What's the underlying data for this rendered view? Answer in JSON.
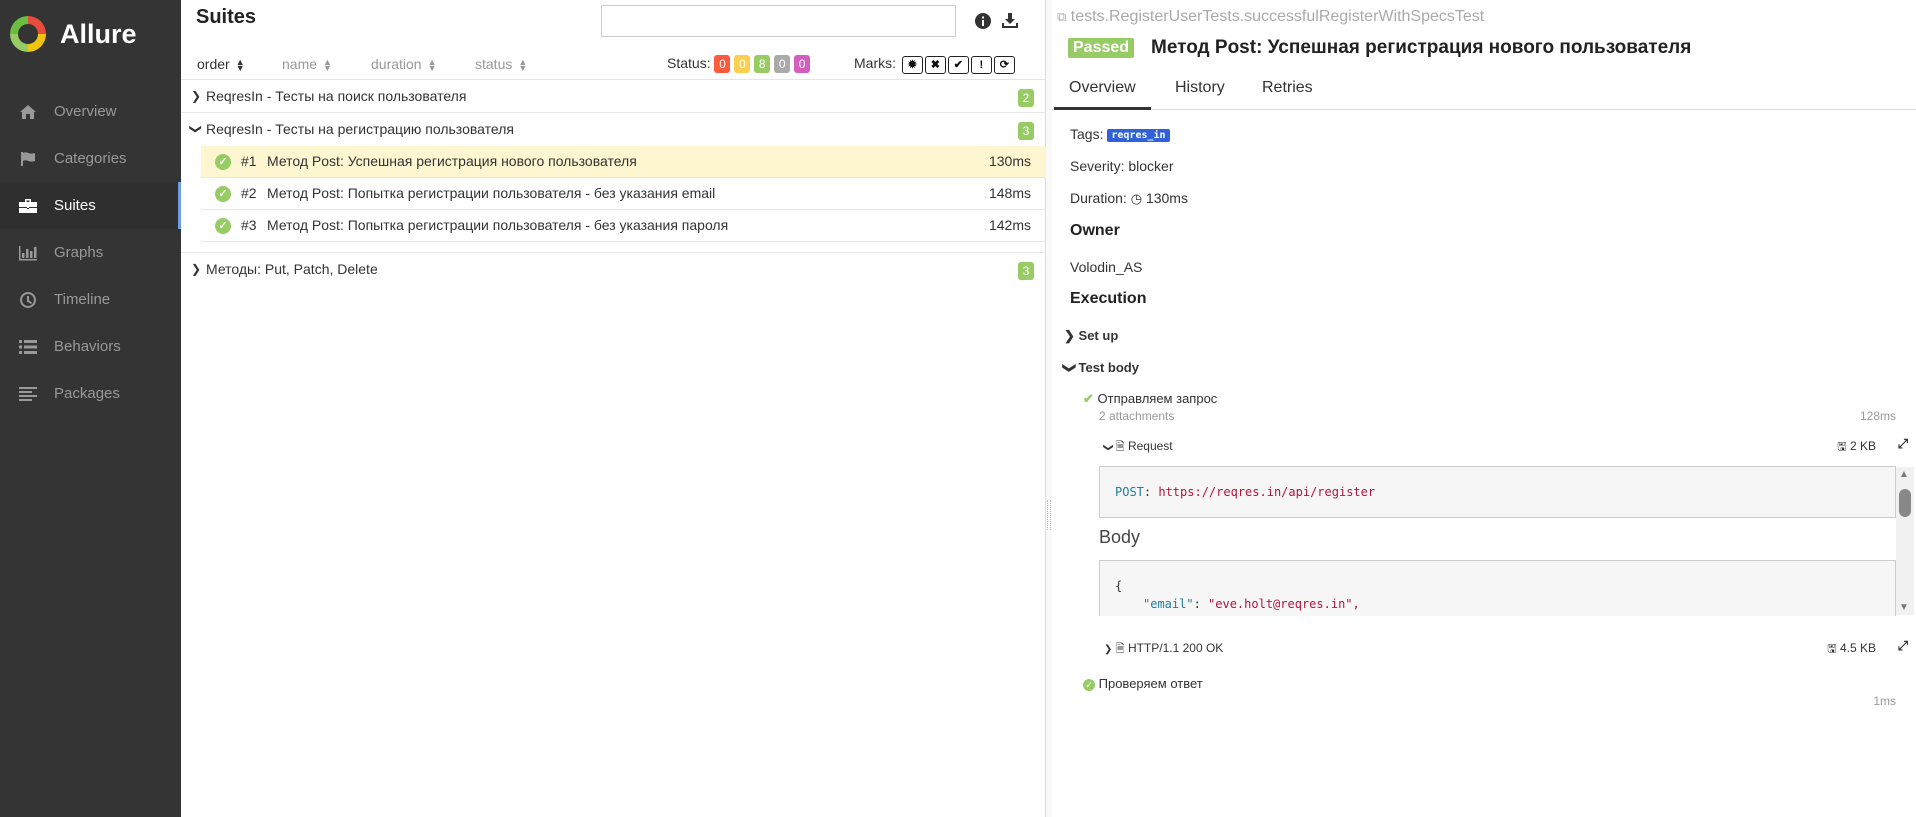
{
  "app": {
    "title": "Allure"
  },
  "sidebar": {
    "items": [
      {
        "label": "Overview",
        "icon": "home-icon"
      },
      {
        "label": "Categories",
        "icon": "flag-icon"
      },
      {
        "label": "Suites",
        "icon": "briefcase-icon",
        "active": true
      },
      {
        "label": "Graphs",
        "icon": "bar-chart-icon"
      },
      {
        "label": "Timeline",
        "icon": "clock-icon"
      },
      {
        "label": "Behaviors",
        "icon": "list-icon"
      },
      {
        "label": "Packages",
        "icon": "align-left-icon"
      }
    ]
  },
  "suites": {
    "title": "Suites",
    "search": {
      "value": "",
      "placeholder": ""
    },
    "sort": {
      "order": "order",
      "name": "name",
      "duration": "duration",
      "status": "status"
    },
    "status_label": "Status:",
    "status_counts": [
      {
        "value": "0",
        "color": "#fd5a3e"
      },
      {
        "value": "0",
        "color": "#ffd050"
      },
      {
        "value": "8",
        "color": "#97cc64"
      },
      {
        "value": "0",
        "color": "#aaaaaa"
      },
      {
        "value": "0",
        "color": "#d35ebe"
      }
    ],
    "marks_label": "Marks:",
    "marks": [
      "flaky-icon",
      "new-failed-icon",
      "new-passed-icon",
      "new-broken-icon",
      "retries-icon"
    ],
    "groups": [
      {
        "name": "ReqresIn - Тесты на поиск пользователя",
        "count": "2",
        "expanded": false
      },
      {
        "name": "ReqresIn - Тесты на регистрацию пользователя",
        "count": "3",
        "expanded": true
      },
      {
        "name": "Методы: Put, Patch, Delete",
        "count": "3",
        "expanded": false
      }
    ],
    "tests": [
      {
        "num": "#1",
        "name": "Метод Post: Успешная регистрация нового пользователя",
        "duration": "130ms",
        "selected": true
      },
      {
        "num": "#2",
        "name": "Метод Post: Попытка регистрации пользователя - без указания email",
        "duration": "148ms"
      },
      {
        "num": "#3",
        "name": "Метод Post: Попытка регистрации пользователя - без указания пароля",
        "duration": "142ms"
      }
    ]
  },
  "detail": {
    "path": "tests.RegisterUserTests.successfulRegisterWithSpecsTest",
    "status": "Passed",
    "title": "Метод Post: Успешная регистрация нового пользователя",
    "tabs": [
      "Overview",
      "History",
      "Retries"
    ],
    "tags_label": "Tags:",
    "tag": "reqres_in",
    "severity": "Severity: blocker",
    "duration_label": "Duration:",
    "duration": "130ms",
    "owner_heading": "Owner",
    "owner": "Volodin_AS",
    "execution_heading": "Execution",
    "setup": "Set up",
    "test_body": "Test body",
    "step1": {
      "name": "Отправляем запрос",
      "sub": "2 attachments",
      "duration": "128ms"
    },
    "request": {
      "name": "Request",
      "size": "2 KB",
      "method": "POST",
      "url": "https://reqres.in/api/register",
      "body_heading": "Body",
      "brace": "{",
      "key": "\"email\"",
      "value": "\"eve.holt@reqres.in\","
    },
    "response": {
      "name": "HTTP/1.1 200 OK",
      "size": "4.5 KB"
    },
    "step2": {
      "name": "Проверяем ответ",
      "duration": "1ms"
    }
  },
  "colors": {
    "sidebar_bg": "#343434",
    "passed": "#97cc64",
    "tag": "#3061d9",
    "active_accent": "#6b9edf"
  }
}
